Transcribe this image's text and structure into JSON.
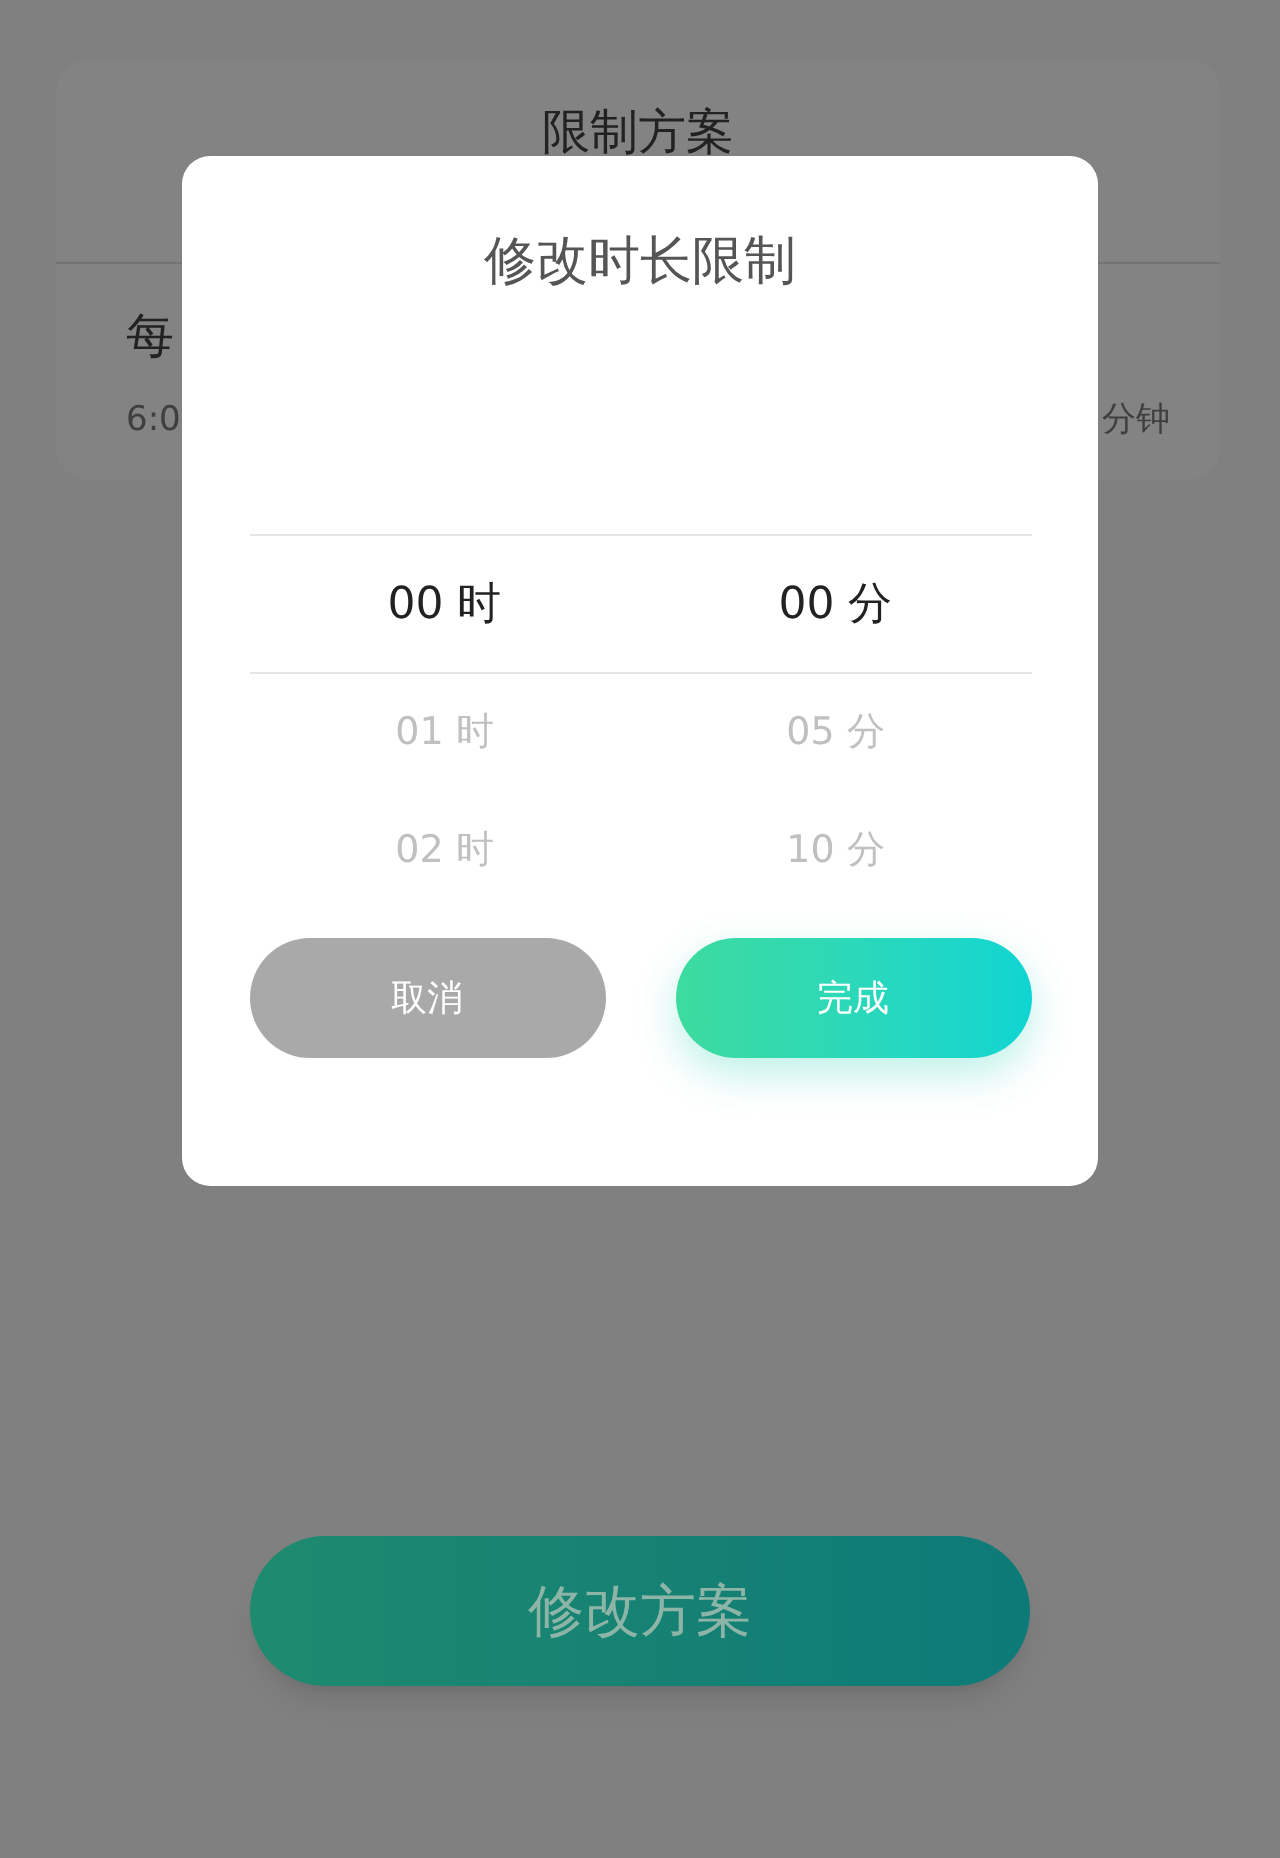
{
  "plan_card": {
    "title": "限制方案",
    "plan_name": "每",
    "time": "6:0",
    "duration": "分钟"
  },
  "dialog": {
    "title": "修改时长限制",
    "columns": [
      {
        "items": [
          {
            "label": "00 时",
            "selected": true
          },
          {
            "label": "01 时",
            "selected": false
          },
          {
            "label": "02 时",
            "selected": false
          }
        ]
      },
      {
        "items": [
          {
            "label": "00 分",
            "selected": true
          },
          {
            "label": "05 分",
            "selected": false
          },
          {
            "label": "10 分",
            "selected": false
          }
        ]
      }
    ],
    "buttons": [
      {
        "label": "取消",
        "kind": "cancel"
      },
      {
        "label": "完成",
        "kind": "confirm"
      }
    ]
  },
  "modify_button": {
    "label": "修改方案"
  }
}
